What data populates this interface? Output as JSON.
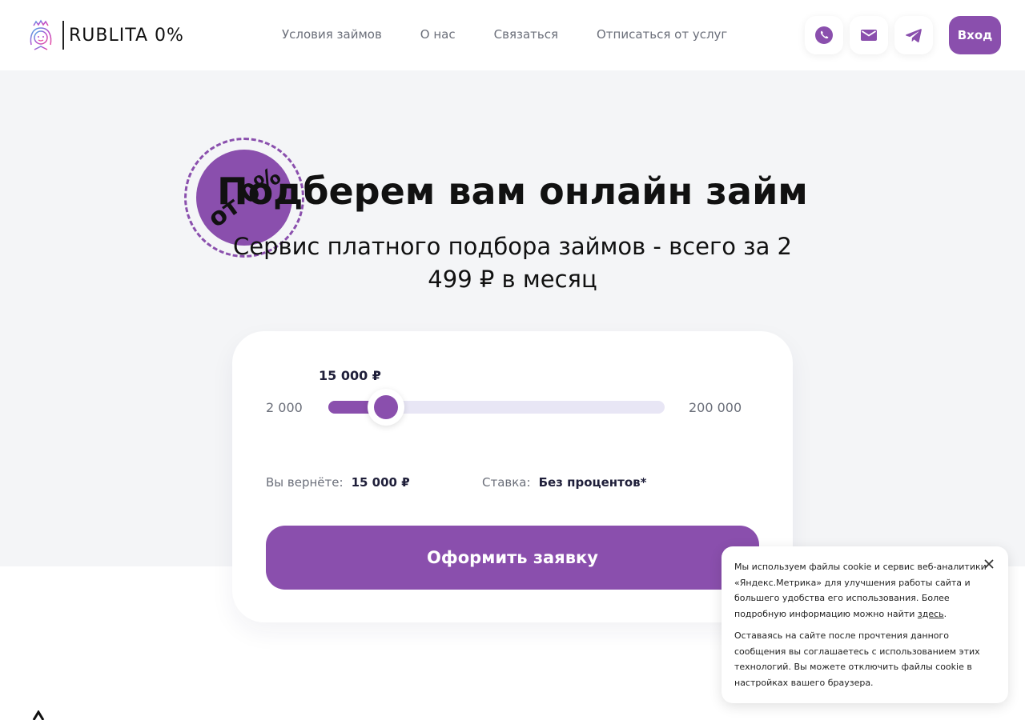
{
  "header": {
    "logo_text": "RUBLITA 0%",
    "nav": [
      "Условия займов",
      "О нас",
      "Связаться",
      "Отписаться от услуг"
    ],
    "login_label": "Вход",
    "contact_icons": [
      "phone-icon",
      "mail-icon",
      "telegram-icon"
    ]
  },
  "hero": {
    "badge": "от 0%",
    "title": "Подберем вам онлайн займ",
    "subtitle": "Сервис платного подбора займов - всего за 2 499 ₽ в месяц"
  },
  "calculator": {
    "amount_label": "15 000 ₽",
    "min": "2 000",
    "max": "200 000",
    "slider": {
      "min": 2000,
      "max": 200000,
      "value": 15000
    },
    "return_label": "Вы вернёте:",
    "return_value": "15 000 ₽",
    "rate_label": "Ставка:",
    "rate_value": "Без процентов*",
    "submit_label": "Оформить заявку"
  },
  "cookie": {
    "text_before_link": "Мы используем файлы cookie и сервис веб-аналитики «Яндекс.Метрика» для улучшения работы сайта и большего удобства его использования. Более подробную информацию можно найти ",
    "link": "здесь",
    "text_after_link": ".",
    "text2": "Оставаясь на сайте после прочтения данного сообщения вы соглашаетесь с использованием этих технологий. Вы можете отключить файлы cookie в настройках вашего браузера."
  },
  "colors": {
    "accent": "#8a4fad",
    "hero_bg": "#f4f5f7",
    "track_bg": "#e8e6f5"
  }
}
